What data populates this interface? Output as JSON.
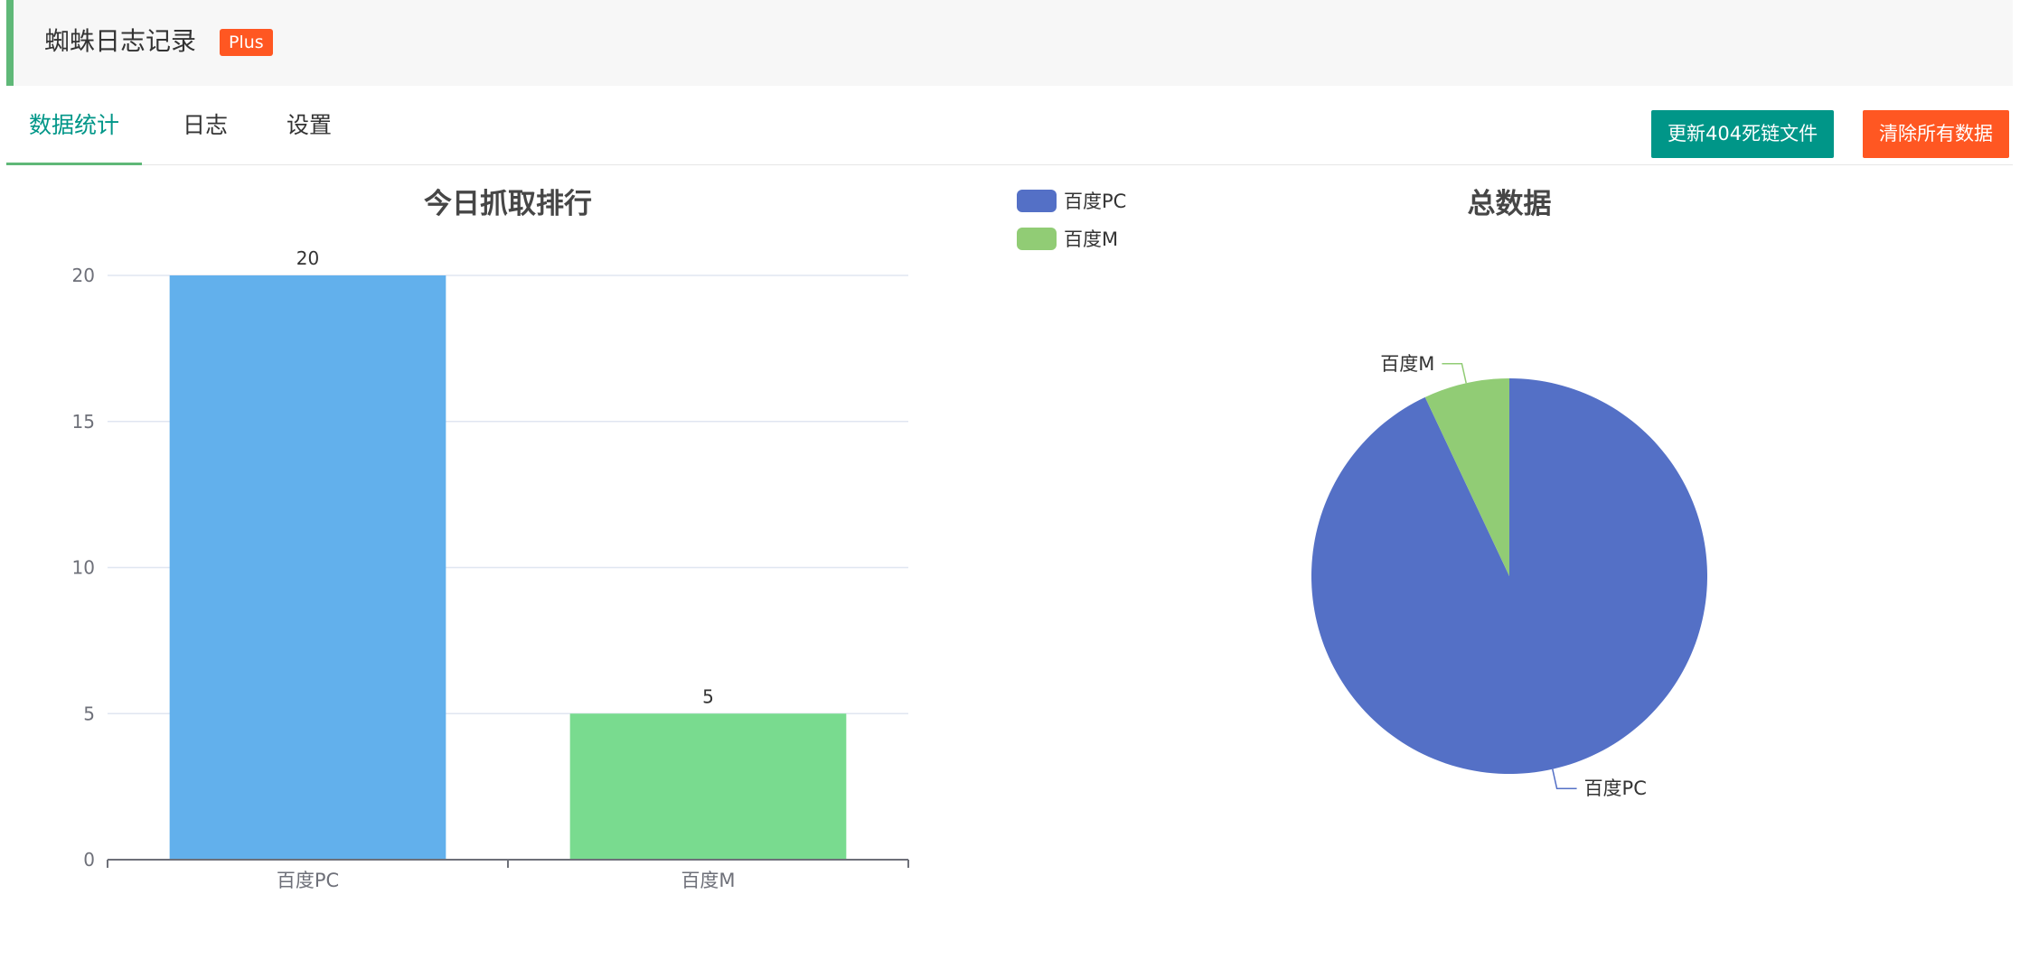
{
  "header": {
    "title": "蜘蛛日志记录",
    "badge": "Plus"
  },
  "tabs": [
    {
      "label": "数据统计",
      "active": true
    },
    {
      "label": "日志",
      "active": false
    },
    {
      "label": "设置",
      "active": false
    }
  ],
  "actions": {
    "update_404": "更新404死链文件",
    "clear_all": "清除所有数据"
  },
  "colors": {
    "accent": "#009688",
    "danger": "#ff5722",
    "header_bar": "#5fb878",
    "bar_pc": "#62b0ec",
    "bar_m": "#79db8f",
    "pie_pc": "#5470c6",
    "pie_m": "#91cc75"
  },
  "chart_data": [
    {
      "type": "bar",
      "title": "今日抓取排行",
      "categories": [
        "百度PC",
        "百度M"
      ],
      "values": [
        20,
        5
      ],
      "ylim": [
        0,
        20
      ],
      "yticks": [
        0,
        5,
        10,
        15,
        20
      ],
      "grid": true,
      "data_labels": true
    },
    {
      "type": "pie",
      "title": "总数据",
      "labels": [
        "百度PC",
        "百度M"
      ],
      "values": [
        93,
        7
      ],
      "legend": [
        "百度PC",
        "百度M"
      ],
      "legend_position": "top-left"
    }
  ]
}
